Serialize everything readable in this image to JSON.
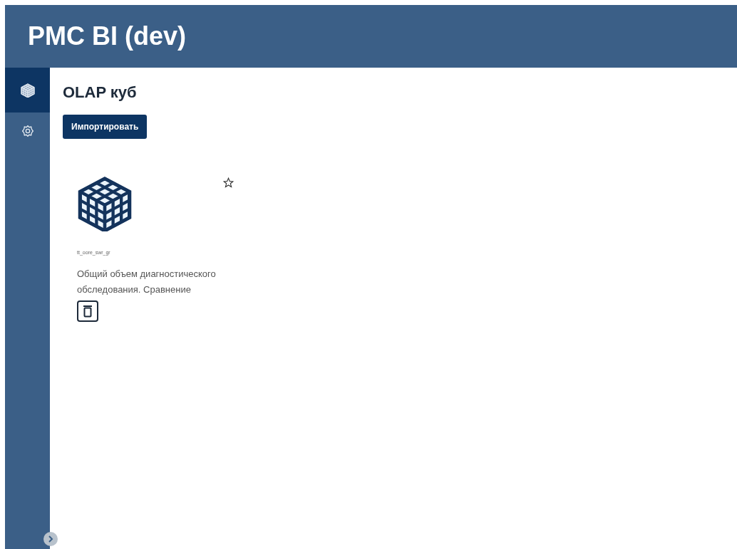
{
  "header": {
    "title": "PMC BI (dev)"
  },
  "sidebar": {
    "items": [
      {
        "kind": "cube",
        "selected": true
      },
      {
        "kind": "settings",
        "selected": false
      }
    ]
  },
  "page": {
    "title": "OLAP куб",
    "import_button": "Импортировать"
  },
  "cards": [
    {
      "code": "tt_oore_swr_gr",
      "name": "Общий объем диагностического обследования. Сравнение",
      "favorite": false
    }
  ]
}
